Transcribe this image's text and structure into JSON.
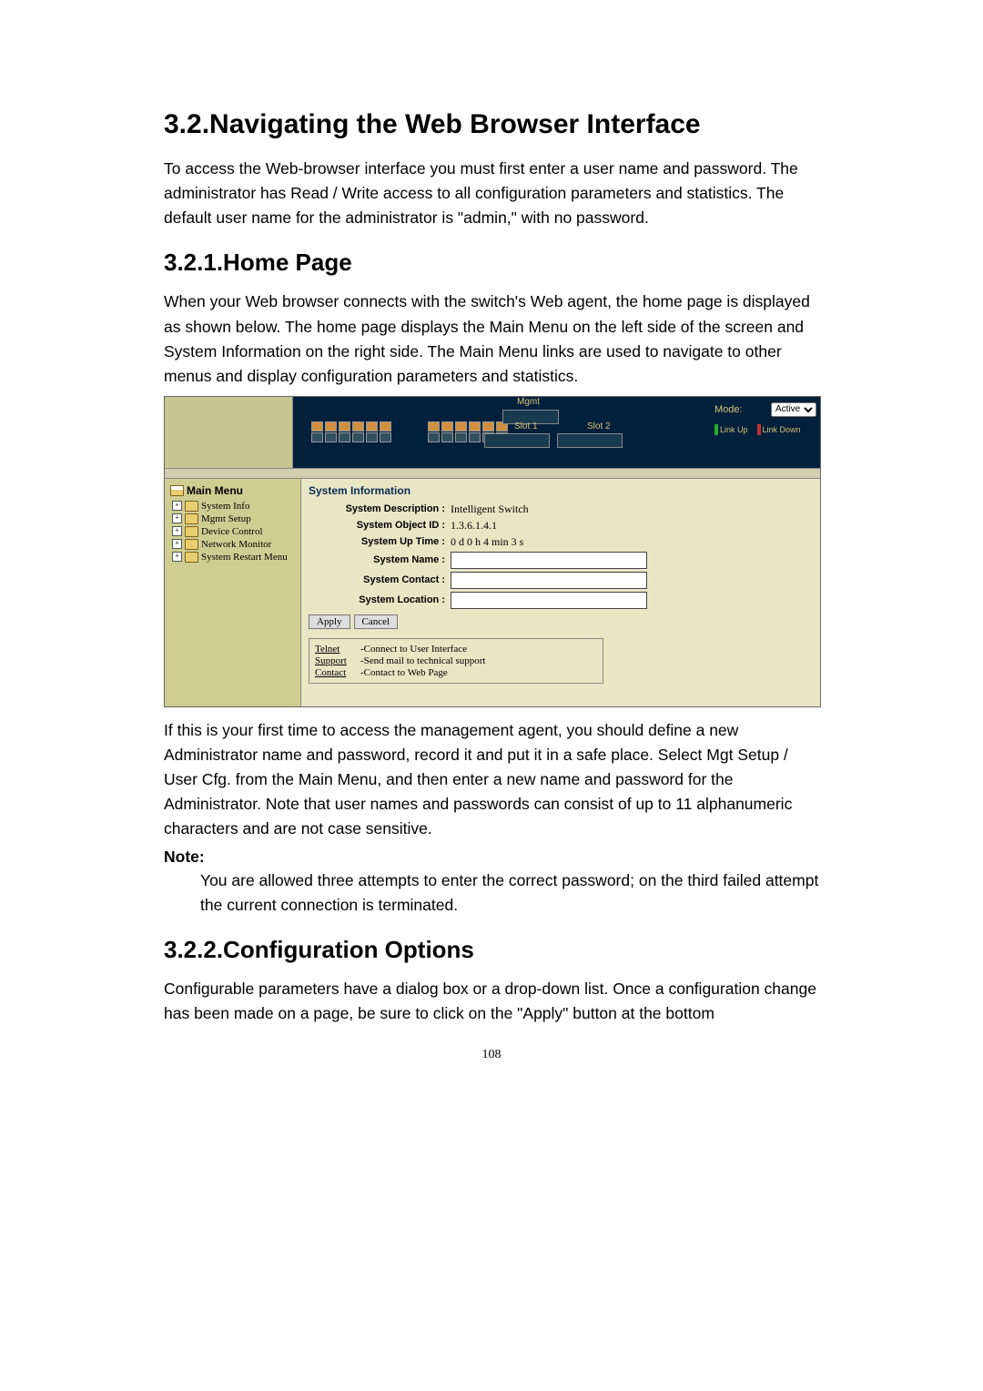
{
  "headings": {
    "h1": "3.2.Navigating the Web Browser Interface",
    "h2a": "3.2.1.Home Page",
    "h2b": "3.2.2.Configuration Options"
  },
  "paragraphs": {
    "p1": "To access the Web-browser interface you must first enter a user name and password. The administrator has Read / Write access to all configuration parameters and statistics. The default user name for the administrator is \"admin,\" with no password.",
    "p2": "When your Web browser connects with the switch's Web agent, the home page is displayed as shown below. The home page displays the Main Menu on the left side of the screen and System Information on the right side. The Main Menu links are used to navigate to other menus and display configuration parameters and statistics.",
    "p3": "If this is your first time to access the management agent, you should define a new Administrator name and password, record it and put it in a safe place. Select Mgt Setup / User Cfg. from the Main Menu, and then enter a new name and password for the Administrator. Note that user names and passwords can consist of up to 11 alphanumeric characters and are not case sensitive.",
    "note_label": "Note:",
    "note_body": "You are allowed three attempts to enter the correct password; on the third failed attempt the current connection is terminated.",
    "p4": "Configurable parameters have a dialog box or a drop-down list. Once a configuration change has been made on a page, be sure to click on the \"Apply\" button at the bottom"
  },
  "screenshot": {
    "slots": {
      "mgmt": "Mgmt",
      "slot1": "Slot 1",
      "slot2": "Slot 2"
    },
    "mode": {
      "label": "Mode:",
      "selected": "Active",
      "link_up": "Link Up",
      "link_down": "Link Down"
    },
    "tree": {
      "title": "Main Menu",
      "items": [
        "System Info",
        "Mgmt Setup",
        "Device Control",
        "Network Monitor",
        "System Restart Menu"
      ]
    },
    "sysinfo": {
      "heading": "System Information",
      "desc_label": "System Description :",
      "desc_value": "Intelligent Switch",
      "oid_label": "System Object ID :",
      "oid_value": "1.3.6.1.4.1",
      "uptime_label": "System Up Time :",
      "uptime_value": "0 d 0 h 4 min 3 s",
      "name_label": "System Name :",
      "name_value": "",
      "contact_label": "System Contact :",
      "contact_value": "",
      "location_label": "System Location :",
      "location_value": "",
      "apply": "Apply",
      "cancel": "Cancel"
    },
    "links": [
      {
        "label": "Telnet",
        "desc": "-Connect to User Interface"
      },
      {
        "label": "Support",
        "desc": "-Send mail to technical support"
      },
      {
        "label": "Contact",
        "desc": "-Contact to Web Page"
      }
    ]
  },
  "page_number": "108"
}
